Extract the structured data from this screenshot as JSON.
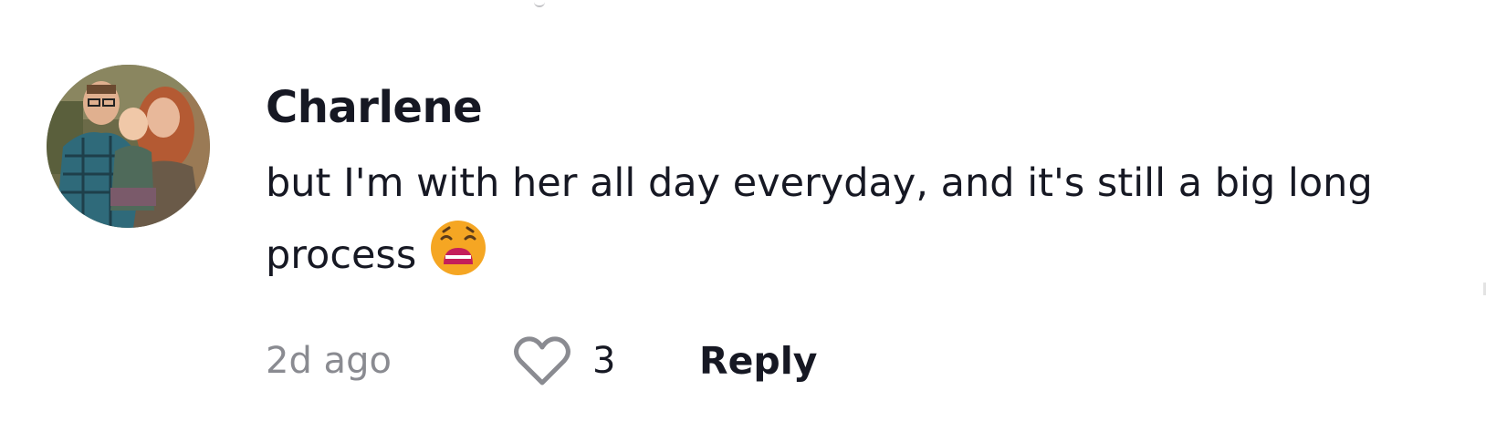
{
  "comment": {
    "username": "Charlene",
    "text": "but I'm with her all day everyday, and it's still a big long process",
    "emoji": "weary-face-emoji",
    "timestamp": "2d ago",
    "like_count": "3",
    "reply_label": "Reply",
    "avatar": "family-photo-avatar"
  },
  "icons": {
    "like": "heart-outline-icon"
  },
  "colors": {
    "text_primary": "#161823",
    "text_secondary": "#8a8b91",
    "icon_stroke": "#8a8b91",
    "emoji_face": "#f5a623",
    "emoji_mouth": "#c41e5a"
  }
}
